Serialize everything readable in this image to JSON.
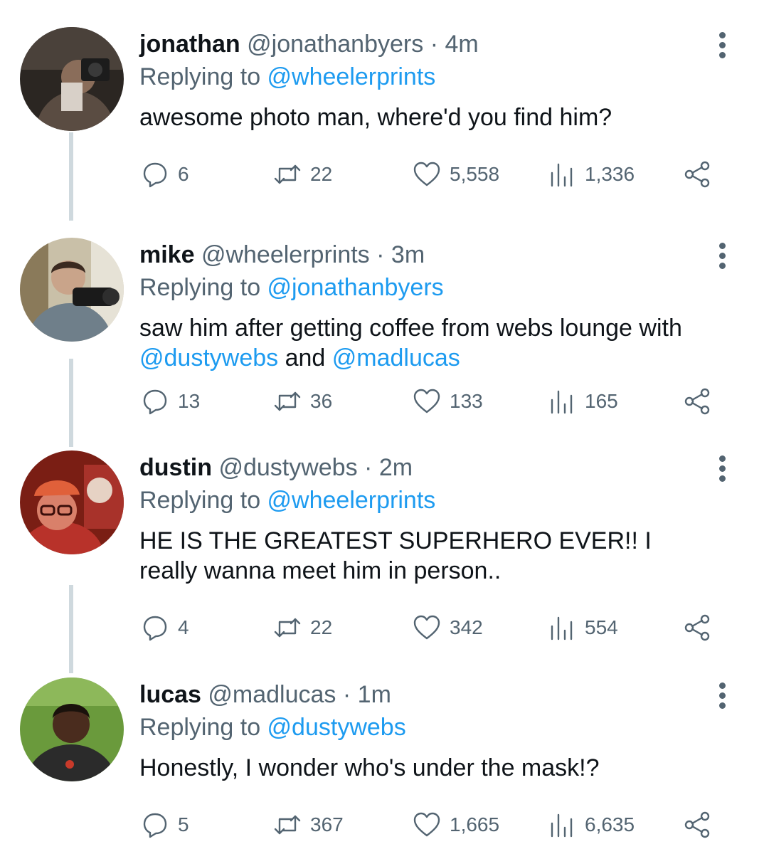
{
  "colors": {
    "link": "#1d9bf0",
    "muted": "#536471",
    "text": "#0f1419",
    "thread_line": "#cfd9de"
  },
  "icons": {
    "reply": "reply-icon",
    "retweet": "retweet-icon",
    "like": "heart-icon",
    "views": "views-icon",
    "share": "share-icon",
    "more": "more-icon"
  },
  "tweets": [
    {
      "name": "jonathan",
      "handle": "@jonathanbyers",
      "dot": " · ",
      "time": "4m",
      "replying_label": "Replying to ",
      "replying_to": "@wheelerprints",
      "text_plain": "awesome photo man, where'd you find him?",
      "stats": {
        "replies": "6",
        "retweets": "22",
        "likes": "5,558",
        "views": "1,336"
      }
    },
    {
      "name": "mike",
      "handle": "@wheelerprints",
      "dot": " · ",
      "time": "3m",
      "replying_label": "Replying to ",
      "replying_to": "@jonathanbyers",
      "text_plain": "saw him after getting coffee from webs lounge with",
      "mention_1": "@dustywebs",
      "text_and": " and ",
      "mention_2": "@madlucas",
      "stats": {
        "replies": "13",
        "retweets": "36",
        "likes": "133",
        "views": "165"
      }
    },
    {
      "name": "dustin",
      "handle": "@dustywebs",
      "dot": " · ",
      "time": "2m",
      "replying_label": "Replying to ",
      "replying_to": "@wheelerprints",
      "text_plain": "HE IS THE GREATEST SUPERHERO EVER!! I really wanna meet him in person..",
      "stats": {
        "replies": "4",
        "retweets": "22",
        "likes": "342",
        "views": "554"
      }
    },
    {
      "name": "lucas",
      "handle": "@madlucas",
      "dot": " · ",
      "time": "1m",
      "replying_label": "Replying to ",
      "replying_to": "@dustywebs",
      "text_plain": "Honestly, I wonder who's under the mask!?",
      "stats": {
        "replies": "5",
        "retweets": "367",
        "likes": "1,665",
        "views": "6,635"
      }
    }
  ]
}
